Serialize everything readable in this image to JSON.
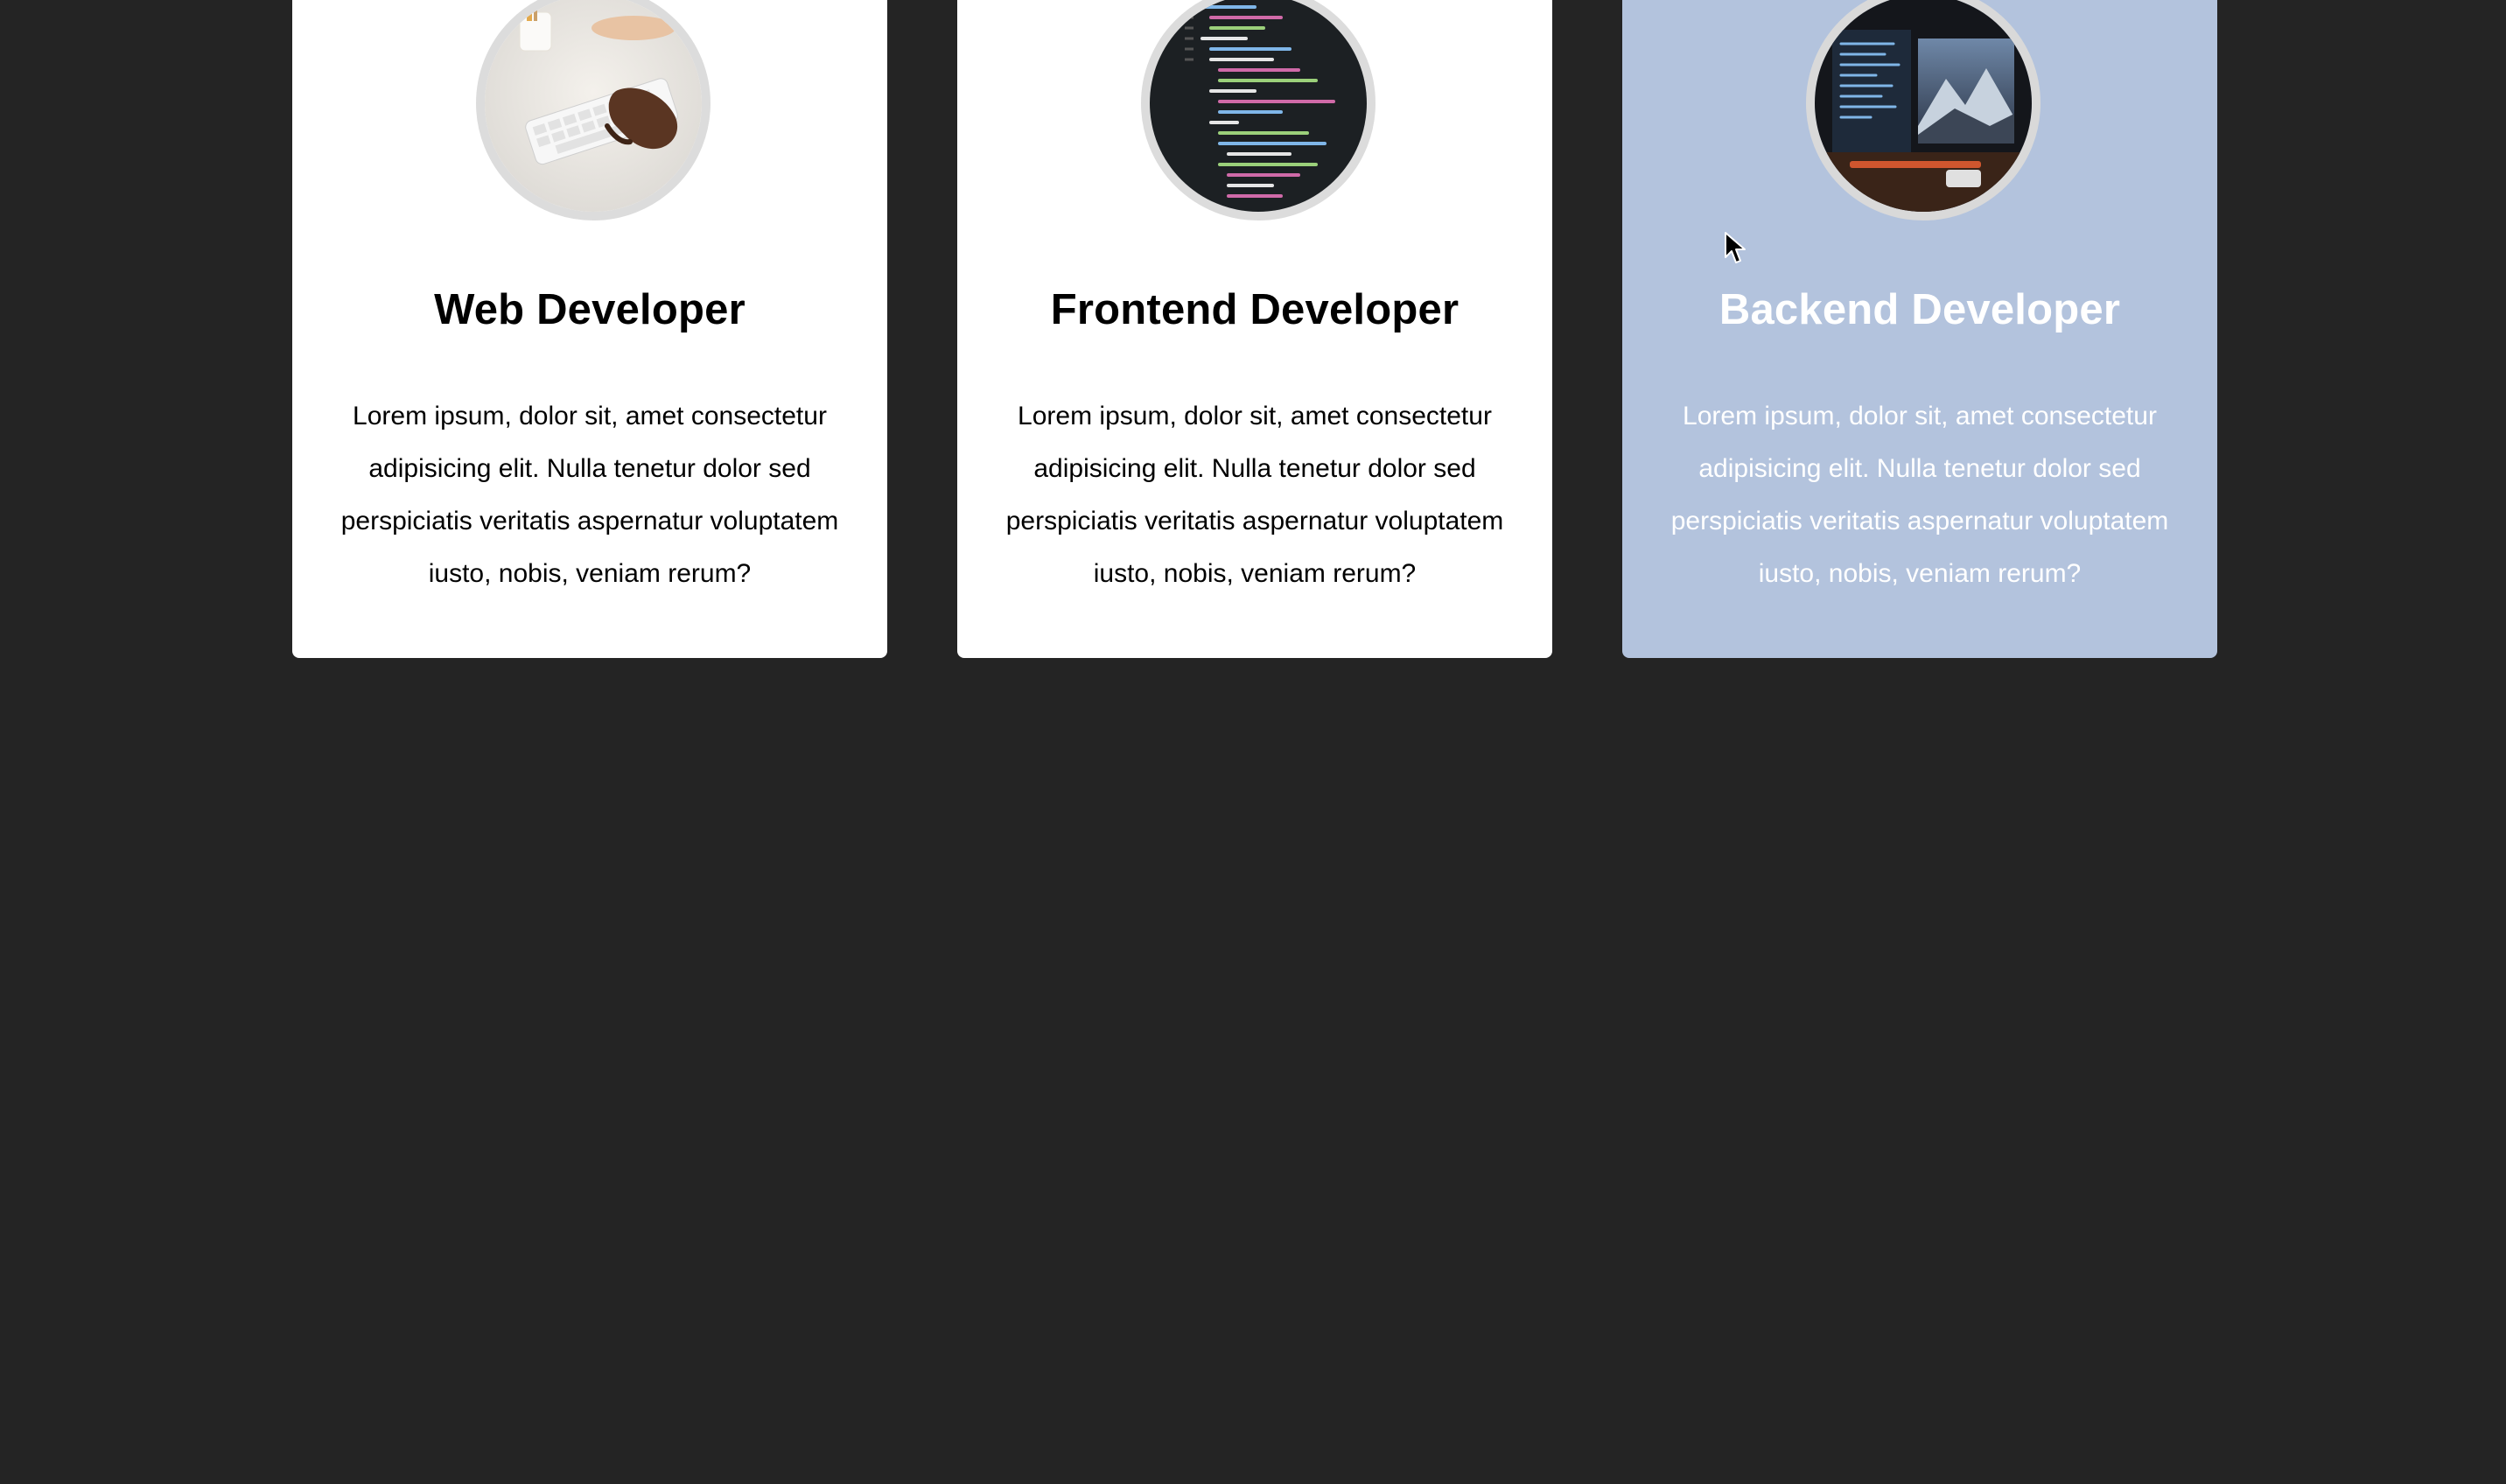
{
  "cards": [
    {
      "title": "Web Developer",
      "description": "Lorem ipsum, dolor sit, amet consectetur adipisicing elit. Nulla tenetur dolor sed perspiciatis veritatis aspernatur voluptatem iusto, nobis, veniam rerum?",
      "image": "keyboard-typing-photo",
      "highlighted": false
    },
    {
      "title": "Frontend Developer",
      "description": "Lorem ipsum, dolor sit, amet consectetur adipisicing elit. Nulla tenetur dolor sed perspiciatis veritatis aspernatur voluptatem iusto, nobis, veniam rerum?",
      "image": "code-editor-photo",
      "highlighted": false
    },
    {
      "title": "Backend Developer",
      "description": "Lorem ipsum, dolor sit, amet consectetur adipisicing elit. Nulla tenetur dolor sed perspiciatis veritatis aspernatur voluptatem iusto, nobis, veniam rerum?",
      "image": "monitor-setup-photo",
      "highlighted": true
    }
  ],
  "colors": {
    "page_background": "#242424",
    "card_background": "#ffffff",
    "card_hover_background": "#b3c3dd",
    "avatar_border": "#dcdcdc"
  }
}
